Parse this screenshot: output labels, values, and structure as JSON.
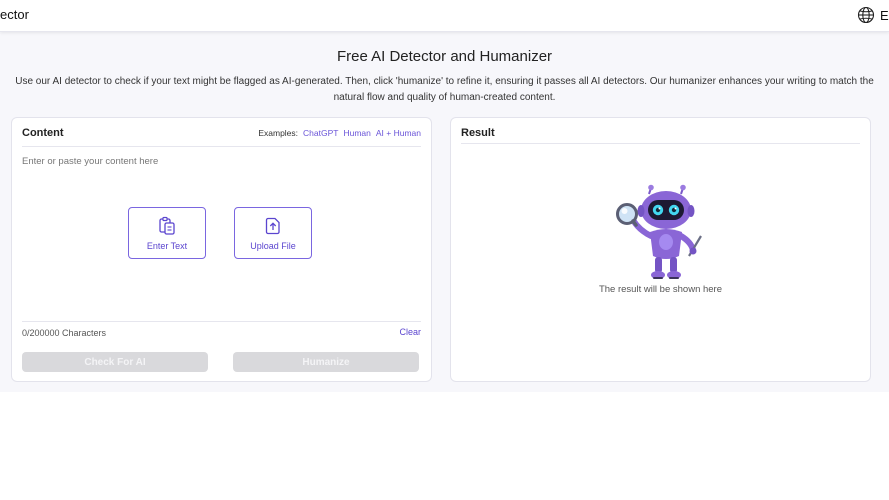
{
  "header": {
    "brand": "ector",
    "language": "English"
  },
  "page": {
    "title": "Free AI Detector and Humanizer",
    "description": "Use our AI detector to check if your text might be flagged as AI-generated. Then, click 'humanize' to refine it, ensuring it passes all AI detectors. Our humanizer enhances your writing to match the natural flow and quality of human-created content."
  },
  "content_panel": {
    "title": "Content",
    "examples_label": "Examples:",
    "examples": [
      "ChatGPT",
      "Human",
      "AI + Human"
    ],
    "placeholder": "Enter or paste your content here",
    "enter_text_label": "Enter Text",
    "upload_file_label": "Upload File",
    "char_count": "0/200000 Characters",
    "clear_label": "Clear",
    "check_label": "Check For AI",
    "humanize_label": "Humanize"
  },
  "result_panel": {
    "title": "Result",
    "empty_text": "The result will be shown here"
  },
  "colors": {
    "accent": "#6a54d8",
    "disabled_button": "#d9d9dc",
    "robot_body": "#8a66d6"
  }
}
